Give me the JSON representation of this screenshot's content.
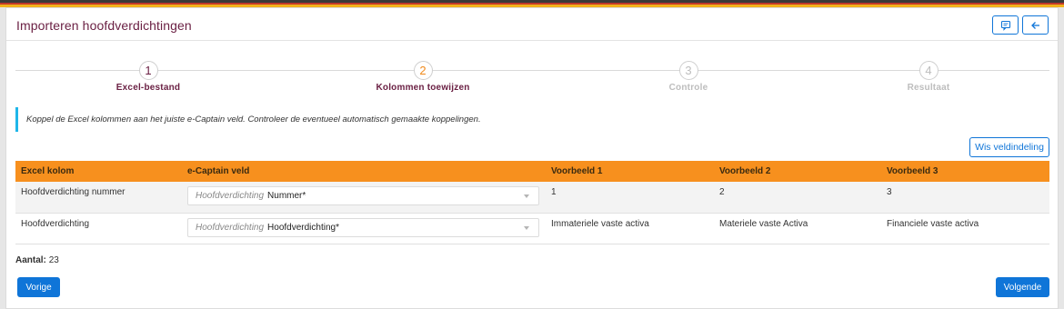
{
  "window": {
    "title": "Importeren hoofdverdichtingen"
  },
  "header_buttons": [
    {
      "icon": "comment-icon"
    },
    {
      "icon": "arrow-left-icon"
    }
  ],
  "steps": [
    {
      "number": "1",
      "label": "Excel-bestand",
      "state": "done"
    },
    {
      "number": "2",
      "label": "Kolommen toewijzen",
      "state": "active"
    },
    {
      "number": "3",
      "label": "Controle",
      "state": "todo"
    },
    {
      "number": "4",
      "label": "Resultaat",
      "state": "todo"
    }
  ],
  "info": {
    "text": "Koppel de Excel kolommen aan het juiste e-Captain veld. Controleer de eventueel automatisch gemaakte koppelingen."
  },
  "clear_button": {
    "label": "Wis veldindeling"
  },
  "table": {
    "headers": [
      "Excel kolom",
      "e-Captain veld",
      "Voorbeeld 1",
      "Voorbeeld 2",
      "Voorbeeld 3"
    ],
    "rows": [
      {
        "excel": "Hoofdverdichting nummer",
        "field_placeholder": "Hoofdverdichting",
        "field_value": "Nummer*",
        "ex1": "1",
        "ex2": "2",
        "ex3": "3"
      },
      {
        "excel": "Hoofdverdichting",
        "field_placeholder": "Hoofdverdichting",
        "field_value": "Hoofdverdichting*",
        "ex1": "Immateriele vaste activa",
        "ex2": "Materiele vaste Activa",
        "ex3": "Financiele vaste activa"
      }
    ]
  },
  "count": {
    "label": "Aantal:",
    "value": "23"
  },
  "prev_button": {
    "label": "Vorige"
  },
  "next_button": {
    "label": "Volgende"
  },
  "colors": {
    "accent": "#0f75d8",
    "header_orange": "#f7901e",
    "title": "#6b2144",
    "info_border": "#1fb6e9"
  }
}
